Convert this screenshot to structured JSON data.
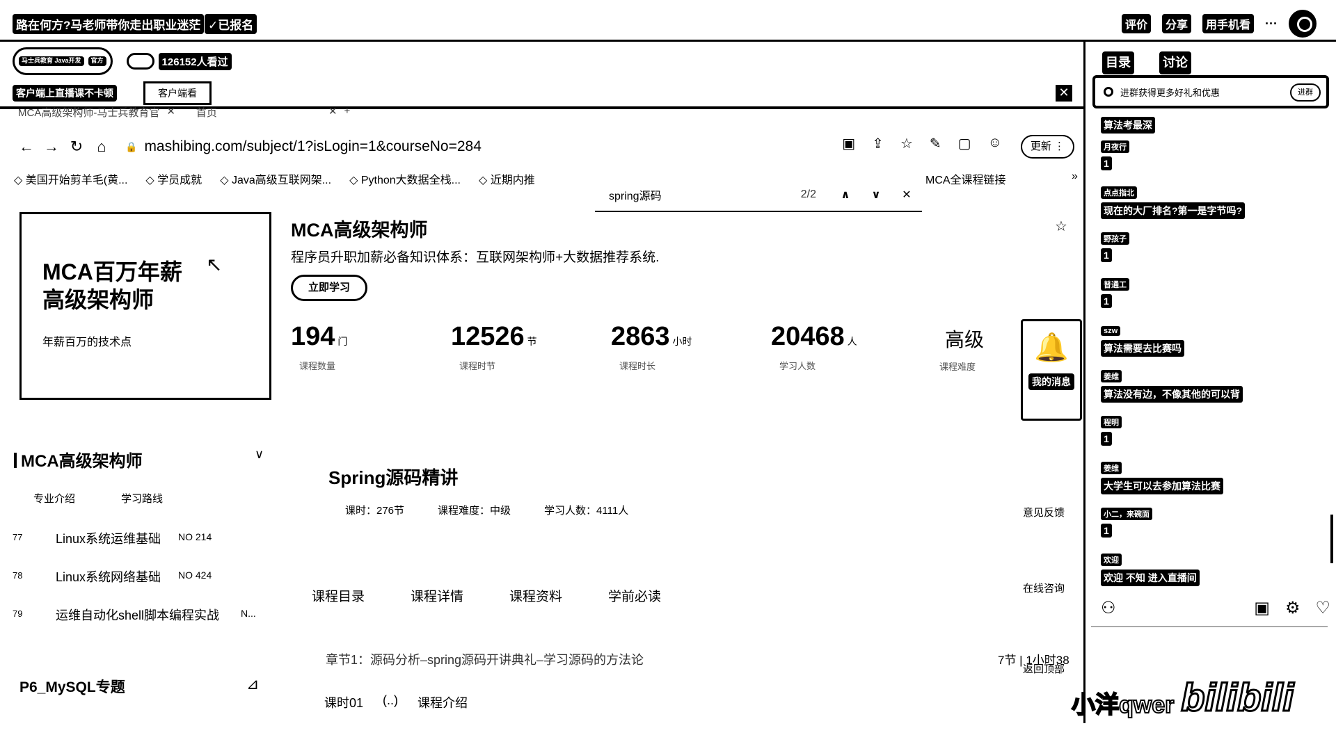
{
  "topbar": {
    "title": "路在何方?马老师带你走出职业迷茫",
    "signed": "✓已报名",
    "actions": [
      "评价",
      "分享",
      "用手机看",
      "···"
    ]
  },
  "live": {
    "logo_text": "马士兵教育 Java开发",
    "logo_badge": "官方",
    "views": "126152人看过",
    "notice": "客户端上直播课不卡顿",
    "tab_label": "客户端看",
    "close": "✕"
  },
  "browser": {
    "tabs": [
      "MCA高级架构师-马士兵教育官",
      "✕",
      "首页",
      "✕",
      "+"
    ],
    "nav": [
      "←",
      "→",
      "↻",
      "⌂"
    ],
    "url": "mashibing.com/subject/1?isLogin=1&courseNo=284",
    "lock": "🔒",
    "tool_icons": [
      "▣",
      "⇪",
      "☆",
      "✎",
      "▢",
      "☺"
    ],
    "update_label": "更新 ⋮",
    "bookmarks": [
      "美国开始剪羊毛(黄...",
      "学员成就",
      "Java高级互联网架...",
      "Python大数据全栈...",
      "近期内推"
    ],
    "bookmark_right": "MCA全课程链接",
    "bookmark_more": "»",
    "find": {
      "query": "spring源码",
      "count": "2/2",
      "up": "∧",
      "down": "∨",
      "close": "✕"
    }
  },
  "page": {
    "cover": {
      "line1": "MCA百万年薪",
      "line2": "高级架构师",
      "tagline": "年薪百万的技术点",
      "cursor": "↖"
    },
    "course_title": "MCA高级架构师",
    "course_desc": "程序员升职加薪必备知识体系：互联网架构师+大数据推荐系统.",
    "star": "☆",
    "button_label": "立即学习",
    "stats": [
      {
        "num": "194",
        "unit": "门",
        "label": "课程数量"
      },
      {
        "num": "12526",
        "unit": "节",
        "label": "课程时节"
      },
      {
        "num": "2863",
        "unit": "小时",
        "label": "课程时长"
      },
      {
        "num": "20468",
        "unit": "人",
        "label": "学习人数"
      }
    ],
    "level": {
      "value": "高级",
      "label": "课程难度"
    },
    "message_box": {
      "icon": "🔔",
      "label": "我的消息"
    },
    "side_tools": [
      "意见反馈",
      "在线咨询",
      "返回顶部"
    ],
    "section_title": "MCA高级架构师",
    "section_chevron": "∨",
    "sub_tabs": [
      "专业介绍",
      "学习路线"
    ],
    "lessons": [
      {
        "idx": "77",
        "name": "Linux系统运维基础",
        "no": "NO 214"
      },
      {
        "idx": "78",
        "name": "Linux系统网络基础",
        "no": "NO 424"
      },
      {
        "idx": "79",
        "name": "运维自动化shell脚本编程实战",
        "no": "N..."
      }
    ],
    "p6_title": "P6_MySQL专题",
    "p6_icon": "⊿",
    "spring": {
      "title": "Spring源码精讲",
      "meta": [
        "课时：276节",
        "课程难度：中级",
        "学习人数：4111人"
      ],
      "tabs": [
        "课程目录",
        "课程详情",
        "课程资料",
        "学前必读"
      ],
      "chapter": "章节1：源码分析–spring源码开讲典礼–学习源码的方法论",
      "chapter_meta": "7节 | 1小时38",
      "lesson_num": "课时01",
      "lesson_type": "(..)",
      "lesson_name": "课程介绍"
    }
  },
  "right_panel": {
    "tabs": [
      "目录",
      "讨论"
    ],
    "active_tab": "讨论",
    "promo_text": "进群获得更多好礼和优惠",
    "promo_btn": "进群",
    "messages": [
      {
        "user": "",
        "text": "算法考最深"
      },
      {
        "user": "月夜行",
        "text": "1"
      },
      {
        "user": "点点指北",
        "text": "现在的大厂排名?第一是字节吗?"
      },
      {
        "user": "野孩子",
        "text": "1"
      },
      {
        "user": "普通工",
        "text": "1"
      },
      {
        "user": "szw",
        "text": "算法需要去比赛吗"
      },
      {
        "user": "姜维",
        "text": "算法没有边，不像其他的可以背"
      },
      {
        "user": "程明",
        "text": "1"
      },
      {
        "user": "姜维",
        "text": "大学生可以去参加算法比赛"
      },
      {
        "user": "小二，来碗面",
        "text": "1"
      },
      {
        "user": "欢迎",
        "text": "欢迎 不知 进入直播间"
      }
    ],
    "bottom_icons": [
      "⚇",
      "▣",
      "⚙",
      "♡"
    ]
  },
  "watermark": {
    "name": "小洋qwer",
    "logo": "bilibili"
  }
}
